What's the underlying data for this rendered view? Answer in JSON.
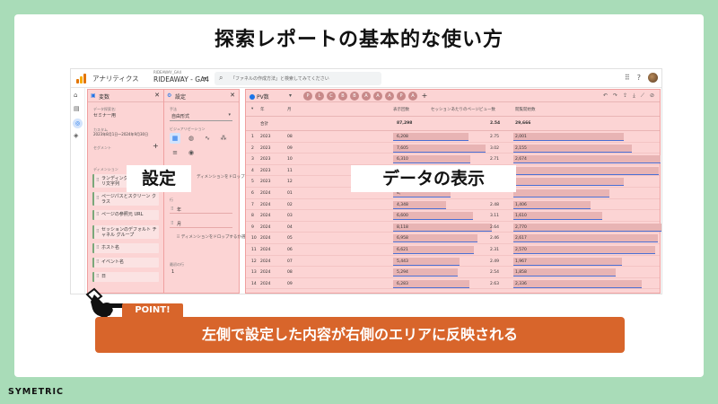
{
  "slide": {
    "title": "探索レポートの基本的な使い方",
    "overlay_settings": "設定",
    "overlay_data": "データの表示",
    "point_label": "POINT!",
    "point_text": "左側で設定した内容が右側のエリアに反映される",
    "brand": "SYMETRIC"
  },
  "ga": {
    "app_name": "アナリティクス",
    "property_small": "RIDEAWAY_GA4",
    "property_name": "RIDEAWAY - GA4",
    "search_placeholder": "「ファネルの作成方法」と検索してみてください",
    "icons": [
      "apps-icon",
      "help-icon",
      "avatar"
    ]
  },
  "variables_panel": {
    "title": "変数",
    "exploration_name_label": "データ探索名:",
    "exploration_name": "セミナー用",
    "custom_label": "カスタム",
    "date_range": "2023年8月1日〜2024年9月30日",
    "segment_label": "セグメント",
    "dimension_label": "ディメンション",
    "dimensions": [
      "ランディング ページ + クエリ文字列",
      "ページパスとスクリーン クラス",
      "ページの参照元 URL",
      "セッションのデフォルト チャネル グループ",
      "ホスト名",
      "イベント名",
      "日"
    ]
  },
  "settings_panel": {
    "title": "設定",
    "technique_label": "手法",
    "technique_value": "自由形式",
    "viz_label": "ビジュアリゼーション",
    "drop_text_1": "ディメンションをドロップするか選択してください",
    "rows_label": "行",
    "rows": [
      "年",
      "月"
    ],
    "drop_text_2": "ディメンションをドロップするか選択してください",
    "start_row_label": "最初の行",
    "start_row_value": "1"
  },
  "table_panel": {
    "tab_name": "PV数",
    "chips": [
      "P",
      "L",
      "C",
      "B",
      "B",
      "A",
      "A",
      "A",
      "P",
      "A"
    ],
    "headers": [
      "年",
      "月",
      "表示回数",
      "セッションあたりのページビュー数",
      "閲覧開始数"
    ],
    "total_label": "合計",
    "totals": [
      "87,298",
      "2.54",
      "29,666"
    ],
    "rows": [
      {
        "n": "1",
        "year": "2023",
        "month": "08",
        "views": "6,208",
        "pps": "2.75",
        "entries": "2,001",
        "views_v": 6208,
        "entries_v": 2001
      },
      {
        "n": "2",
        "year": "2023",
        "month": "09",
        "views": "7,605",
        "pps": "3.02",
        "entries": "2,155",
        "views_v": 7605,
        "entries_v": 2155
      },
      {
        "n": "3",
        "year": "2023",
        "month": "10",
        "views": "6,310",
        "pps": "2.71",
        "entries": "2,674",
        "views_v": 6310,
        "entries_v": 2674
      },
      {
        "n": "4",
        "year": "2023",
        "month": "11",
        "views": "6,4",
        "pps": "",
        "entries": "",
        "views_v": 6420,
        "entries_v": 2640
      },
      {
        "n": "5",
        "year": "2023",
        "month": "12",
        "views": "5,",
        "pps": "",
        "entries": "",
        "views_v": 5600,
        "entries_v": 2000
      },
      {
        "n": "6",
        "year": "2024",
        "month": "01",
        "views": "4,",
        "pps": "",
        "entries": "",
        "views_v": 4700,
        "entries_v": 1750
      },
      {
        "n": "7",
        "year": "2024",
        "month": "02",
        "views": "4,348",
        "pps": "2.48",
        "entries": "1,406",
        "views_v": 4348,
        "entries_v": 1406
      },
      {
        "n": "8",
        "year": "2024",
        "month": "03",
        "views": "6,600",
        "pps": "3.11",
        "entries": "1,610",
        "views_v": 6600,
        "entries_v": 1610
      },
      {
        "n": "9",
        "year": "2024",
        "month": "04",
        "views": "8,118",
        "pps": "2.64",
        "entries": "2,770",
        "views_v": 8118,
        "entries_v": 2770
      },
      {
        "n": "10",
        "year": "2024",
        "month": "05",
        "views": "6,958",
        "pps": "2.46",
        "entries": "2,617",
        "views_v": 6958,
        "entries_v": 2617
      },
      {
        "n": "11",
        "year": "2024",
        "month": "06",
        "views": "6,621",
        "pps": "2.31",
        "entries": "2,570",
        "views_v": 6621,
        "entries_v": 2570
      },
      {
        "n": "12",
        "year": "2024",
        "month": "07",
        "views": "5,443",
        "pps": "2.49",
        "entries": "1,967",
        "views_v": 5443,
        "entries_v": 1967
      },
      {
        "n": "13",
        "year": "2024",
        "month": "08",
        "views": "5,294",
        "pps": "2.54",
        "entries": "1,858",
        "views_v": 5294,
        "entries_v": 1858
      },
      {
        "n": "14",
        "year": "2024",
        "month": "09",
        "views": "6,283",
        "pps": "2.63",
        "entries": "2,336",
        "views_v": 6283,
        "entries_v": 2336
      }
    ],
    "max_views": 8118,
    "max_entries": 2770
  },
  "colors": {
    "background": "#a9dcb8",
    "panel_highlight": "#fcd4d4",
    "accent": "#d8652b",
    "bar": "#e8b4b4",
    "bar_line": "#4a6fd4"
  }
}
